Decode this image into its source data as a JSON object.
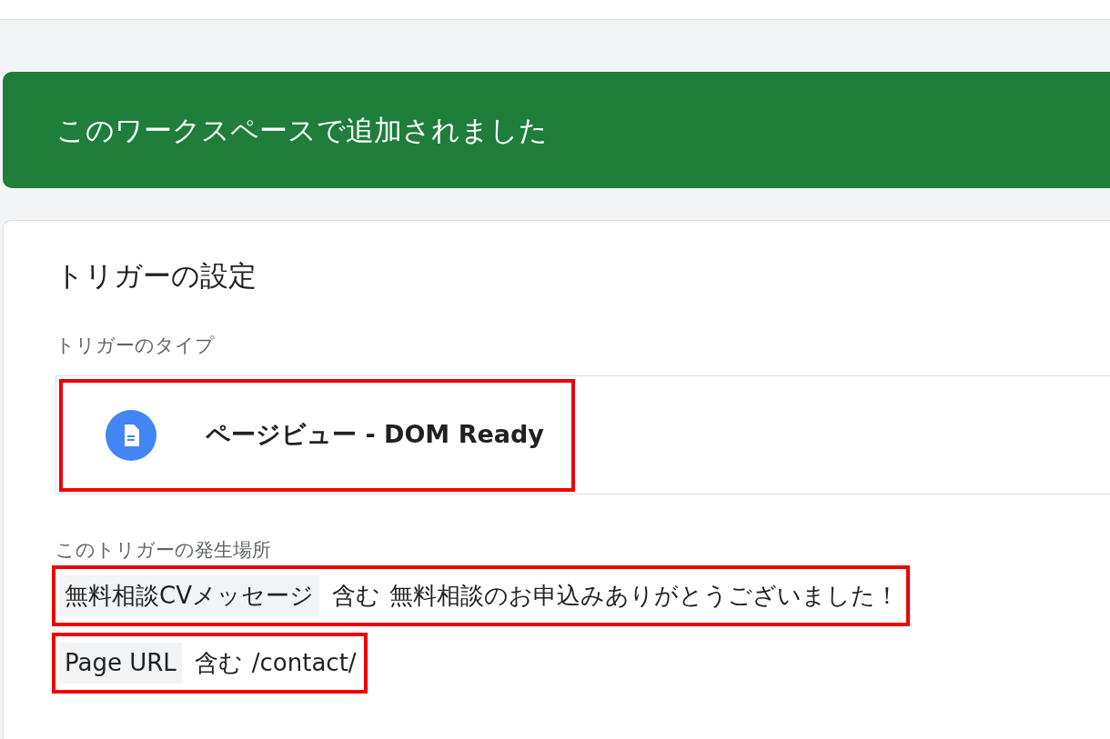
{
  "banner": {
    "text": "このワークスペースで追加されました"
  },
  "card": {
    "title": "トリガーの設定",
    "type_label": "トリガーのタイプ",
    "trigger_type": {
      "name": "ページビュー - DOM Ready",
      "highlighted": true
    },
    "conditions_label": "このトリガーの発生場所",
    "conditions": [
      {
        "variable": "無料相談CVメッセージ",
        "operator": "含む",
        "value": "無料相談のお申込みありがとうございました！",
        "highlighted": true
      },
      {
        "variable": "Page URL",
        "operator": "含む",
        "value": "/contact/",
        "highlighted": true
      }
    ]
  }
}
